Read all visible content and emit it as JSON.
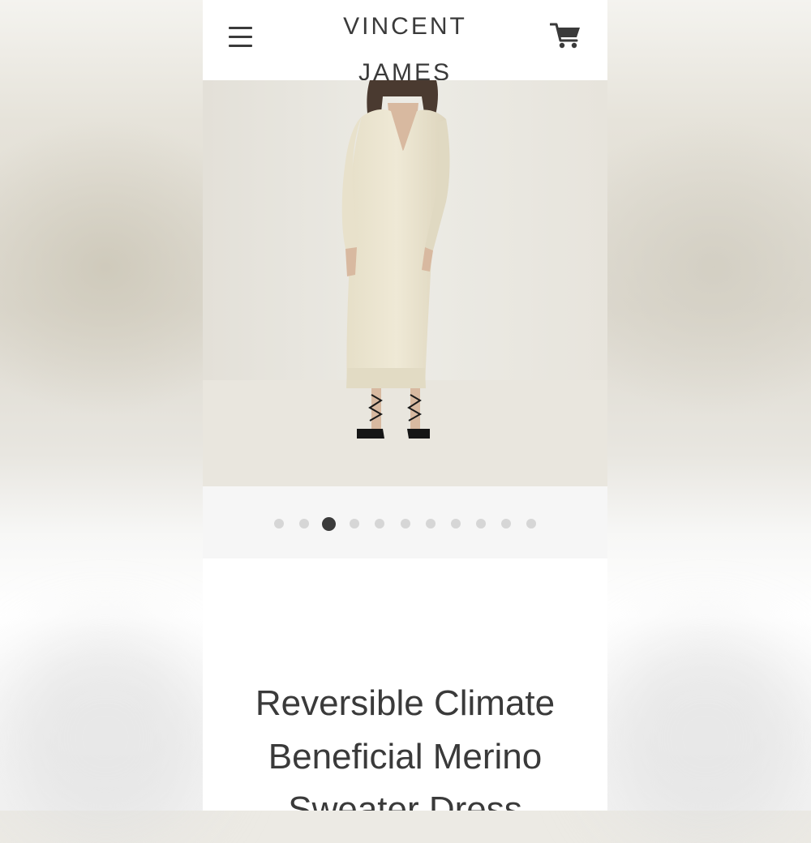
{
  "brand": {
    "line1": "VINCENT",
    "line2": "JAMES"
  },
  "header": {
    "menu_icon": "hamburger-menu-icon",
    "cart_icon": "shopping-cart-icon"
  },
  "hero": {
    "image_subject": "product-photo"
  },
  "carousel": {
    "count": 11,
    "active_index": 3
  },
  "product": {
    "title": "Reversible Climate Beneficial Merino Sweater Dress"
  },
  "colors": {
    "text": "#3a3a3a",
    "dot_inactive": "#d6d6d6",
    "dot_active": "#3b3b3b"
  }
}
